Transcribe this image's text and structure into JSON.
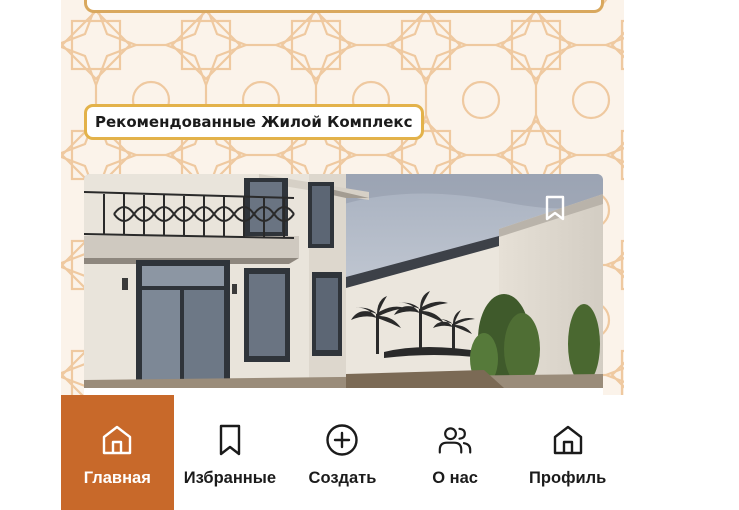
{
  "theme": {
    "accent": "#c8692a",
    "pattern_color": "#efc9a0",
    "title_border": "#e3b24a",
    "nav_text": "#1b1b1b"
  },
  "recommended": {
    "title": "Рекомендованные Жилой Комплекс"
  },
  "listing": {
    "bookmark_icon": "bookmark-icon"
  },
  "nav": {
    "items": [
      {
        "label": "Главная",
        "icon": "home-icon",
        "active": true
      },
      {
        "label": "Избранные",
        "icon": "bookmark-icon",
        "active": false
      },
      {
        "label": "Создать",
        "icon": "plus-circle-icon",
        "active": false
      },
      {
        "label": "О нас",
        "icon": "users-icon",
        "active": false
      },
      {
        "label": "Профиль",
        "icon": "home-icon",
        "active": false
      }
    ]
  }
}
